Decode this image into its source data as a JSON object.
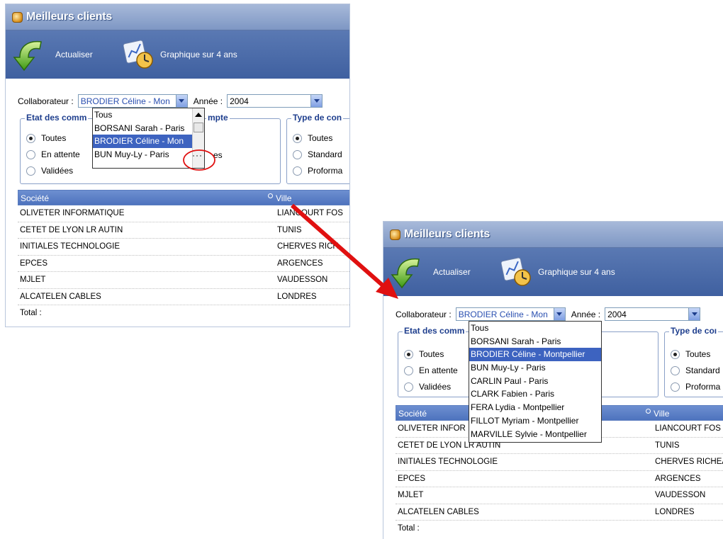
{
  "window": {
    "title": "Meilleurs clients"
  },
  "toolbar": {
    "refresh_label": "Actualiser",
    "chart_label": "Graphique sur 4 ans"
  },
  "filters": {
    "collaborateur_label": "Collaborateur :",
    "collaborateur_value": "BRODIER Céline - Mon",
    "annee_label": "Année :",
    "annee_value": "2004"
  },
  "etat": {
    "title": "Etat des comm",
    "title_clipped": "Etat des comm",
    "title_tail": "mpte",
    "options": [
      "Toutes",
      "En attente",
      "Validées"
    ],
    "selected": "Toutes",
    "partial": "es"
  },
  "type": {
    "title": "Type de con",
    "title_right": "Type de coı",
    "options": [
      "Toutes",
      "Standard",
      "Proforma"
    ],
    "selected": "Toutes"
  },
  "grid": {
    "col_societe": "Société",
    "col_ville": "Ville",
    "rows": [
      {
        "societe": "OLIVETER INFORMATIQUE",
        "societe_clip": "OLIVETER INFOR",
        "ville": "LIANCOURT FOSSE",
        "ville_left": "LIANCOURT FOS",
        "ville_right": "LIANCOURT FOS"
      },
      {
        "societe": "CETET DE LYON LR AUTIN",
        "ville": "TUNIS"
      },
      {
        "societe": "INITIALES TECHNOLOGIE",
        "ville": "CHERVES RICHEMONT",
        "ville_left": "CHERVES RICH",
        "ville_right": "CHERVES RICHEA"
      },
      {
        "societe": "EPCES",
        "ville": "ARGENCES"
      },
      {
        "societe": "MJLET",
        "ville": "VAUDESSON"
      },
      {
        "societe": "ALCATELEN CABLES",
        "ville": "LONDRES"
      }
    ],
    "total_label": "Total :"
  },
  "dropdown_small": [
    "Tous",
    "BORSANI Sarah - Paris",
    "BRODIER Céline - Mon",
    "BUN Muy-Ly - Paris"
  ],
  "dropdown_full": [
    "Tous",
    "BORSANI Sarah - Paris",
    "BRODIER Céline - Montpellier",
    "BUN Muy-Ly - Paris",
    "CARLIN Paul - Paris",
    "CLARK Fabien - Paris",
    "FERA Lydia - Montpellier",
    "FILLOT Myriam - Montpellier",
    "MARVILLE Sylvie - Montpellier"
  ],
  "colors": {
    "title_bar": "#8fa6d0",
    "toolbar": "#4a6aa8",
    "selection": "#3d63c0",
    "annotation": "#e01010"
  }
}
